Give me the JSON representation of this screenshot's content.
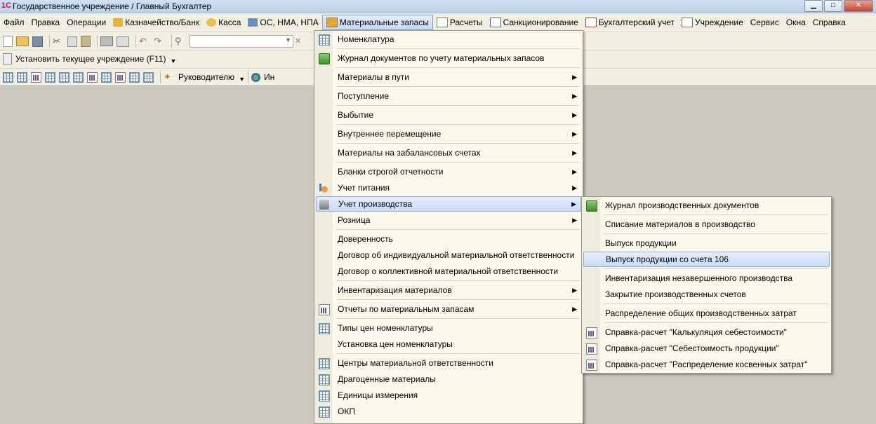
{
  "window": {
    "logo": "1С",
    "title": "Государственное учреждение / Главный Бухгалтер"
  },
  "menubar": [
    {
      "label": "Файл",
      "icon": "none"
    },
    {
      "label": "Правка",
      "icon": "none"
    },
    {
      "label": "Операции",
      "icon": "none"
    },
    {
      "label": "Казначейство/Банк",
      "icon": "bank-icon"
    },
    {
      "label": "Касса",
      "icon": "cash-icon"
    },
    {
      "label": "ОС, НМА, НПА",
      "icon": "truck-icon"
    },
    {
      "label": "Материальные запасы",
      "icon": "materials-icon"
    },
    {
      "label": "Расчеты",
      "icon": "calc-icon"
    },
    {
      "label": "Санкционирование",
      "icon": "sigma-icon"
    },
    {
      "label": "Бухгалтерский учет",
      "icon": "ledger-icon"
    },
    {
      "label": "Учреждение",
      "icon": "document-icon"
    },
    {
      "label": "Сервис",
      "icon": "none"
    },
    {
      "label": "Окна",
      "icon": "none"
    },
    {
      "label": "Справка",
      "icon": "none"
    }
  ],
  "toolbar": {
    "set_institution": "Установить текущее учреждение (F11)",
    "to_manager": "Руководителю",
    "info_prefix": "Ин"
  },
  "main_menu": [
    {
      "label": "Номенклатура",
      "icon": "grid-icon",
      "arrow": false
    },
    {
      "label": "Журнал документов по учету материальных запасов",
      "icon": "journal-icon",
      "arrow": false
    },
    {
      "label": "Материалы в пути",
      "icon": "",
      "arrow": true
    },
    {
      "label": "Поступление",
      "icon": "",
      "arrow": true
    },
    {
      "label": "Выбытие",
      "icon": "",
      "arrow": true
    },
    {
      "label": "Внутреннее перемещение",
      "icon": "",
      "arrow": true
    },
    {
      "label": "Материалы на забалансовых счетах",
      "icon": "",
      "arrow": true
    },
    {
      "label": "Бланки строгой отчетности",
      "icon": "",
      "arrow": true
    },
    {
      "label": "Учет питания",
      "icon": "food-icon",
      "arrow": true
    },
    {
      "label": "Учет производства",
      "icon": "production-icon",
      "arrow": true
    },
    {
      "label": "Розница",
      "icon": "",
      "arrow": true
    },
    {
      "label": "Доверенность",
      "icon": "",
      "arrow": false
    },
    {
      "label": "Договор об индивидуальной материальной ответственности",
      "icon": "",
      "arrow": false
    },
    {
      "label": "Договор о коллективной материальной ответственности",
      "icon": "",
      "arrow": false
    },
    {
      "label": "Инвентаризация материалов",
      "icon": "",
      "arrow": true
    },
    {
      "label": "Отчеты по материальным запасам",
      "icon": "report-icon",
      "arrow": true
    },
    {
      "label": "Типы цен номенклатуры",
      "icon": "grid-icon",
      "arrow": false
    },
    {
      "label": "Установка цен номенклатуры",
      "icon": "",
      "arrow": false
    },
    {
      "label": "Центры материальной ответственности",
      "icon": "grid-icon",
      "arrow": false
    },
    {
      "label": "Драгоценные материалы",
      "icon": "grid-icon",
      "arrow": false
    },
    {
      "label": "Единицы измерения",
      "icon": "grid-icon",
      "arrow": false
    },
    {
      "label": "ОКП",
      "icon": "grid-icon",
      "arrow": false
    }
  ],
  "submenu": [
    {
      "label": "Журнал производственных документов",
      "icon": "journal-icon"
    },
    {
      "label": "Списание материалов в производство",
      "icon": ""
    },
    {
      "label": "Выпуск продукции",
      "icon": ""
    },
    {
      "label": "Выпуск продукции со счета 106",
      "icon": ""
    },
    {
      "label": "Инвентаризация незавершенного производства",
      "icon": ""
    },
    {
      "label": "Закрытие производственных счетов",
      "icon": ""
    },
    {
      "label": "Распределение общих производственных затрат",
      "icon": ""
    },
    {
      "label": "Справка-расчет \"Калькуляция себестоимости\"",
      "icon": "report-icon"
    },
    {
      "label": "Справка-расчет \"Себестоимость продукции\"",
      "icon": "report-icon"
    },
    {
      "label": "Справка-расчет \"Распределение косвенных затрат\"",
      "icon": "report-icon"
    }
  ],
  "colors": {
    "highlight": "#c9dcf6",
    "menu_bg": "#faf9ec",
    "workspace": "#cbc8bd"
  }
}
